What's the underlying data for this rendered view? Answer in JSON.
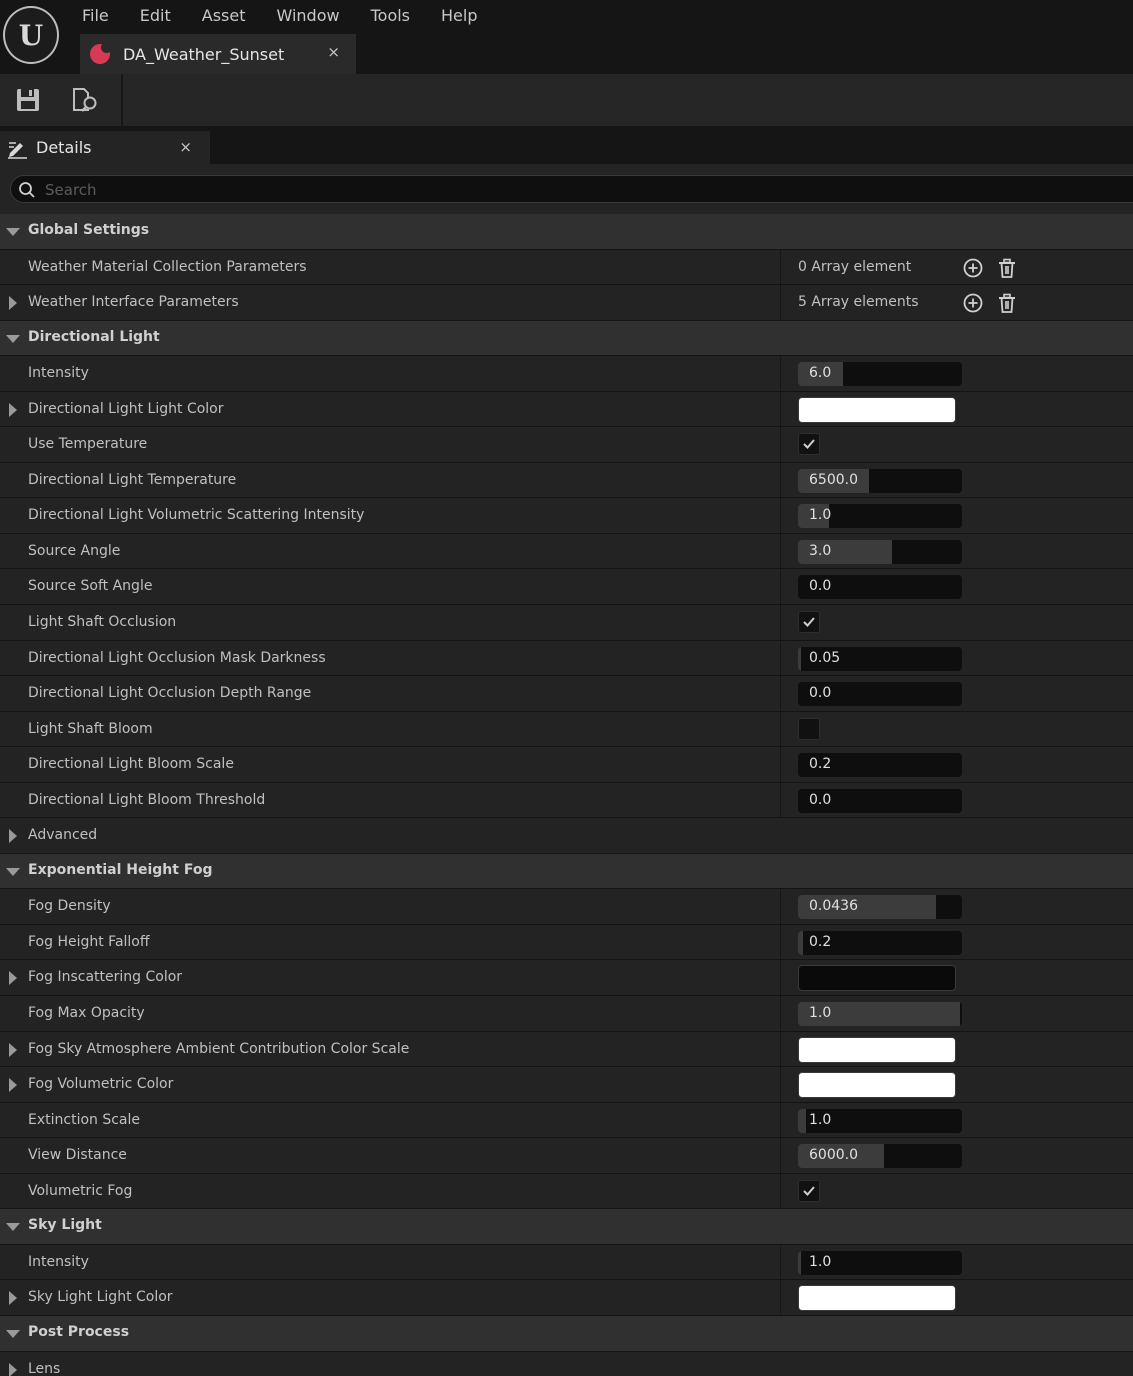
{
  "menubar": {
    "items": [
      "File",
      "Edit",
      "Asset",
      "Window",
      "Tools",
      "Help"
    ]
  },
  "document_tab": {
    "title": "DA_Weather_Sunset",
    "close": "×",
    "icon": "data-asset-icon",
    "icon_color": "#d63a55"
  },
  "toolbar": {
    "buttons": [
      "save-icon",
      "browse-icon"
    ]
  },
  "details_tab": {
    "label": "Details",
    "close": "×",
    "icon": "details-pencil-icon"
  },
  "search": {
    "placeholder": "Search",
    "value": ""
  },
  "rows": [
    {
      "kind": "category",
      "label": "Global Settings"
    },
    {
      "kind": "prop",
      "label": "Weather Material Collection Parameters",
      "expandable": false,
      "value_type": "array",
      "array_text": "0 Array element"
    },
    {
      "kind": "prop",
      "label": "Weather Interface Parameters",
      "expandable": true,
      "value_type": "array",
      "array_text": "5 Array elements"
    },
    {
      "kind": "category",
      "label": "Directional Light"
    },
    {
      "kind": "prop",
      "label": "Intensity",
      "value_type": "number",
      "value": "6.0",
      "fill": 0.28
    },
    {
      "kind": "prop",
      "label": "Directional Light Light Color",
      "expandable": true,
      "value_type": "color",
      "color": "#ffffff"
    },
    {
      "kind": "prop",
      "label": "Use Temperature",
      "value_type": "bool",
      "checked": true
    },
    {
      "kind": "prop",
      "label": "Directional Light Temperature",
      "value_type": "number",
      "value": "6500.0",
      "fill": 0.44
    },
    {
      "kind": "prop",
      "label": "Directional Light Volumetric Scattering Intensity",
      "value_type": "number",
      "value": "1.0",
      "fill": 0.19
    },
    {
      "kind": "prop",
      "label": "Source Angle",
      "value_type": "number",
      "value": "3.0",
      "fill": 0.58
    },
    {
      "kind": "prop",
      "label": "Source Soft Angle",
      "value_type": "number",
      "value": "0.0",
      "fill": 0
    },
    {
      "kind": "prop",
      "label": "Light Shaft Occlusion",
      "value_type": "bool",
      "checked": true
    },
    {
      "kind": "prop",
      "label": "Directional Light Occlusion Mask Darkness",
      "value_type": "number",
      "value": "0.05",
      "fill": 0.02
    },
    {
      "kind": "prop",
      "label": "Directional Light Occlusion Depth Range",
      "value_type": "number",
      "value": "0.0",
      "fill": 0
    },
    {
      "kind": "prop",
      "label": "Light Shaft Bloom",
      "value_type": "bool",
      "checked": false
    },
    {
      "kind": "prop",
      "label": "Directional Light Bloom Scale",
      "value_type": "number",
      "value": "0.2",
      "fill": 0
    },
    {
      "kind": "prop",
      "label": "Directional Light Bloom Threshold",
      "value_type": "number",
      "value": "0.0",
      "fill": 0
    },
    {
      "kind": "prop",
      "label": "Advanced",
      "expandable": true,
      "value_type": "none"
    },
    {
      "kind": "category",
      "label": "Exponential Height Fog"
    },
    {
      "kind": "prop",
      "label": "Fog Density",
      "value_type": "number",
      "value": "0.0436",
      "fill": 0.85
    },
    {
      "kind": "prop",
      "label": "Fog Height Falloff",
      "value_type": "number",
      "value": "0.2",
      "fill": 0.03
    },
    {
      "kind": "prop",
      "label": "Fog Inscattering Color",
      "expandable": true,
      "value_type": "color",
      "color": "#0a0a0a"
    },
    {
      "kind": "prop",
      "label": "Fog Max Opacity",
      "value_type": "number",
      "value": "1.0",
      "fill": 1.0
    },
    {
      "kind": "prop",
      "label": "Fog Sky Atmosphere Ambient Contribution Color Scale",
      "expandable": true,
      "value_type": "color",
      "color": "#ffffff"
    },
    {
      "kind": "prop",
      "label": "Fog Volumetric Color",
      "expandable": true,
      "value_type": "color",
      "color": "#ffffff"
    },
    {
      "kind": "prop",
      "label": "Extinction Scale",
      "value_type": "number",
      "value": "1.0",
      "fill": 0.05
    },
    {
      "kind": "prop",
      "label": "View Distance",
      "value_type": "number",
      "value": "6000.0",
      "fill": 0.53
    },
    {
      "kind": "prop",
      "label": "Volumetric Fog",
      "value_type": "bool",
      "checked": true
    },
    {
      "kind": "category",
      "label": "Sky Light"
    },
    {
      "kind": "prop",
      "label": "Intensity",
      "value_type": "number",
      "value": "1.0",
      "fill": 0.02
    },
    {
      "kind": "prop",
      "label": "Sky Light Light Color",
      "expandable": true,
      "value_type": "color",
      "color": "#ffffff"
    },
    {
      "kind": "category",
      "label": "Post Process"
    },
    {
      "kind": "prop",
      "label": "Lens",
      "expandable": true,
      "value_type": "none"
    }
  ]
}
